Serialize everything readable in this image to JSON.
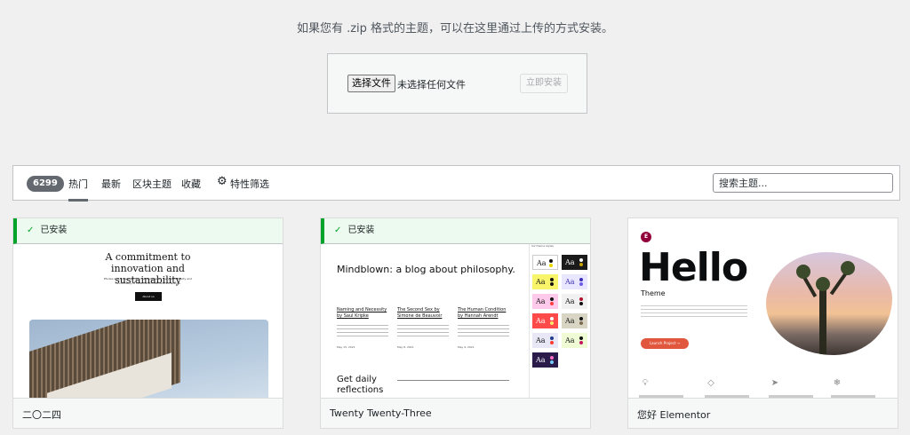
{
  "upload": {
    "hint": "如果您有 .zip 格式的主题，可以在这里通过上传的方式安装。",
    "choose_file_label": "选择文件",
    "file_status": "未选择任何文件",
    "install_label": "立即安装"
  },
  "filter": {
    "count": "6299",
    "tabs": [
      "热门",
      "最新",
      "区块主题",
      "收藏"
    ],
    "active_tab": "热门",
    "feature_filter_label": "特性筛选",
    "search_placeholder": "搜索主题..."
  },
  "themes": [
    {
      "name": "二〇二四",
      "installed": true,
      "installed_label": "已安装",
      "preview": {
        "title": "A commitment to innovation and sustainability",
        "subtitle": "Études is a pioneering firm that seamlessly merges creativity and functionality to redefine architectural excellence.",
        "button": "About us"
      }
    },
    {
      "name": "Twenty Twenty-Three",
      "installed": true,
      "installed_label": "已安装",
      "preview": {
        "headline": "Mindblown: a blog about philosophy.",
        "styles_label": "Six theme styles",
        "posts": [
          {
            "title": "Naming and Necessity by Saul Kripke",
            "date": "May 15, 2021"
          },
          {
            "title": "The Second Sex by Simone de Beauvoir",
            "date": "May 8, 2021"
          },
          {
            "title": "The Human Condition by Hannah Arendt",
            "date": "May 4, 2021"
          }
        ],
        "cta": "Get daily reflections",
        "swatch_label": "Aa"
      }
    },
    {
      "name": "您好 Elementor",
      "installed": false,
      "preview": {
        "logo_letter": "E",
        "headline": "Hello",
        "theme_label": "Theme",
        "button": "Launch Project →"
      }
    }
  ],
  "colors": {
    "installed_green": "#00a32a",
    "installed_bg": "#edfaef",
    "badge_bg": "#646970",
    "elementor_brand": "#92003b",
    "elementor_button": "#e1573e"
  }
}
